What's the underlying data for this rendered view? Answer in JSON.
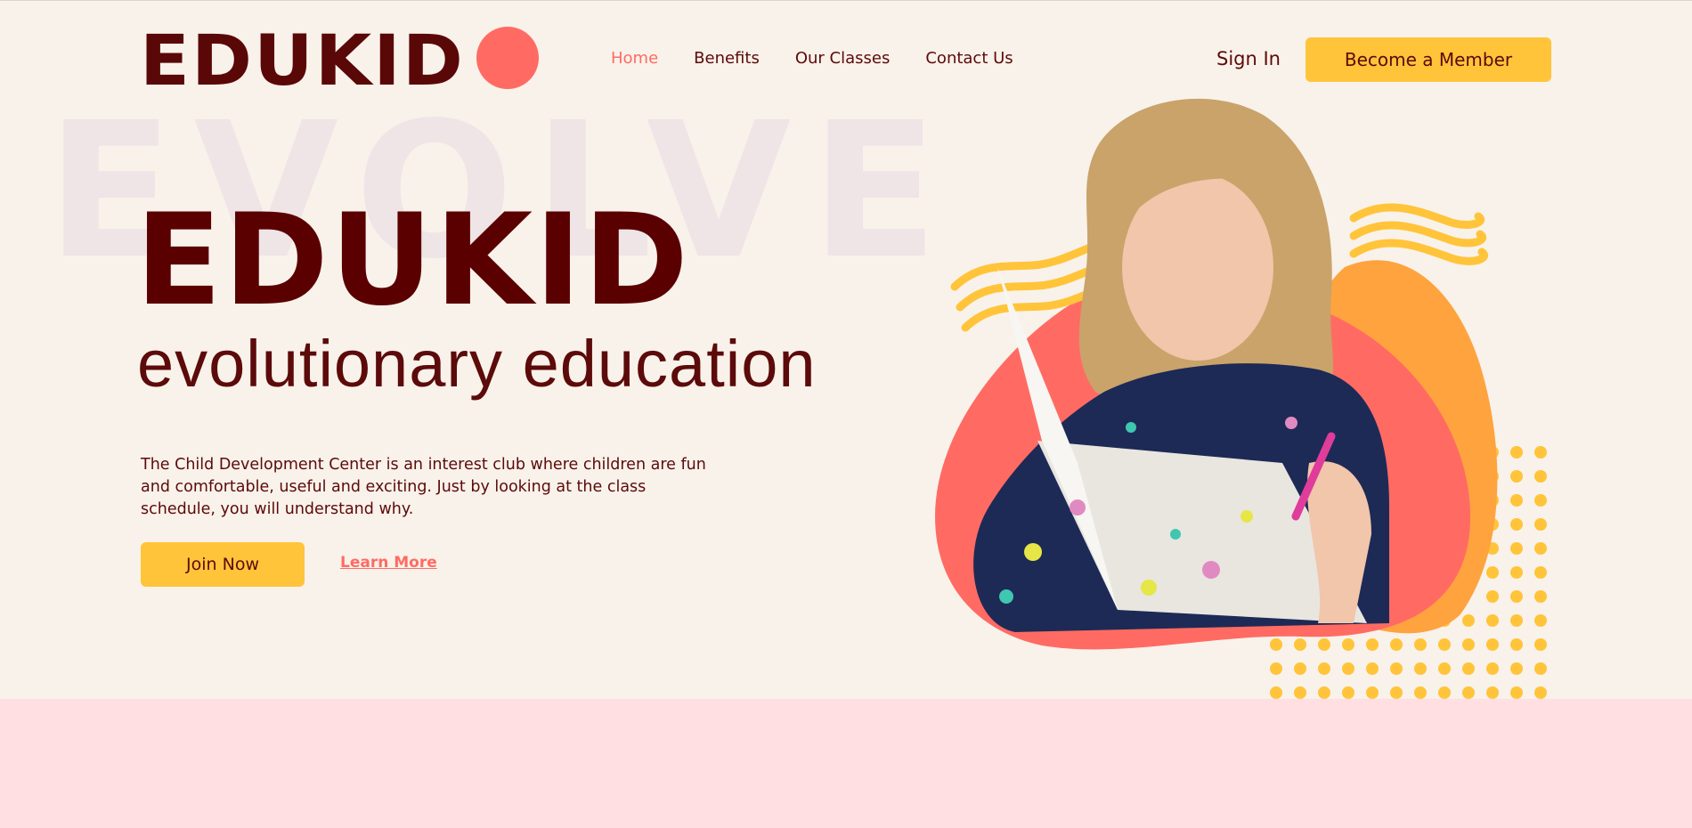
{
  "brand": {
    "logo_text": "EDUKID",
    "accent_dot_color": "#ff6b63"
  },
  "nav": {
    "items": [
      {
        "label": "Home",
        "active": true
      },
      {
        "label": "Benefits",
        "active": false
      },
      {
        "label": "Our Classes",
        "active": false
      },
      {
        "label": "Contact Us",
        "active": false
      }
    ]
  },
  "header": {
    "sign_in": "Sign In",
    "member_button": "Become a Member"
  },
  "hero": {
    "background_word": "EVOLVE",
    "title": "EDUKID",
    "subtitle": "evolutionary education",
    "description": "The Child Development Center is an interest club where children are fun and comfortable, useful and exciting. Just by looking at the class schedule, you will understand why.",
    "join_button": "Join Now",
    "learn_more": "Learn More"
  },
  "colors": {
    "background": "#f8f2ea",
    "primary_text": "#5c0a0a",
    "accent_yellow": "#ffc43a",
    "accent_coral": "#ff6b63",
    "band_pink": "#ffdfe1"
  }
}
